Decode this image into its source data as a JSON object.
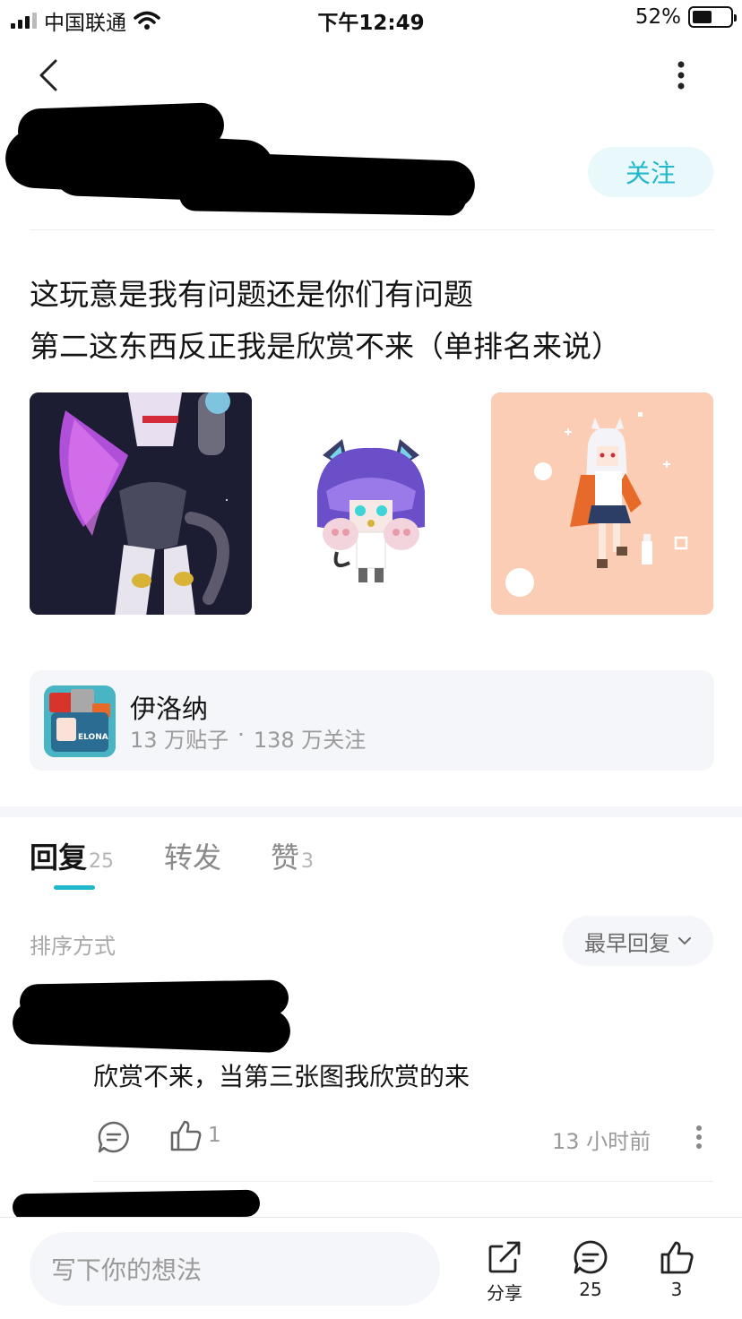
{
  "status_bar": {
    "carrier": "中国联通",
    "time": "下午12:49",
    "battery": "52%",
    "battery_level": 0.52
  },
  "header": {
    "back_icon": "chevron-left-icon",
    "more_icon": "more-vertical-icon"
  },
  "author": {
    "follow_label": "关注"
  },
  "post": {
    "lines": [
      "这玩意是我有问题还是你们有问题",
      "第二这东西反正我是欣赏不来（单排名来说）"
    ]
  },
  "forum": {
    "name": "伊洛纳",
    "posts": "13 万贴子",
    "separator": "·",
    "followers": "138 万关注"
  },
  "tabs": [
    {
      "label": "回复",
      "count": "25",
      "active": true
    },
    {
      "label": "转发",
      "count": "",
      "active": false
    },
    {
      "label": "赞",
      "count": "3",
      "active": false
    }
  ],
  "sort": {
    "label": "排序方式",
    "selected": "最早回复"
  },
  "comment": {
    "text": "欣赏不来，当第三张图我欣赏的来",
    "likes": "1",
    "time": "13 小时前"
  },
  "bottom_bar": {
    "input_placeholder": "写下你的想法",
    "share_label": "分享",
    "comment_count": "25",
    "like_count": "3"
  },
  "colors": {
    "accent": "#22b8cb",
    "follow_bg": "#e9f8fa"
  }
}
